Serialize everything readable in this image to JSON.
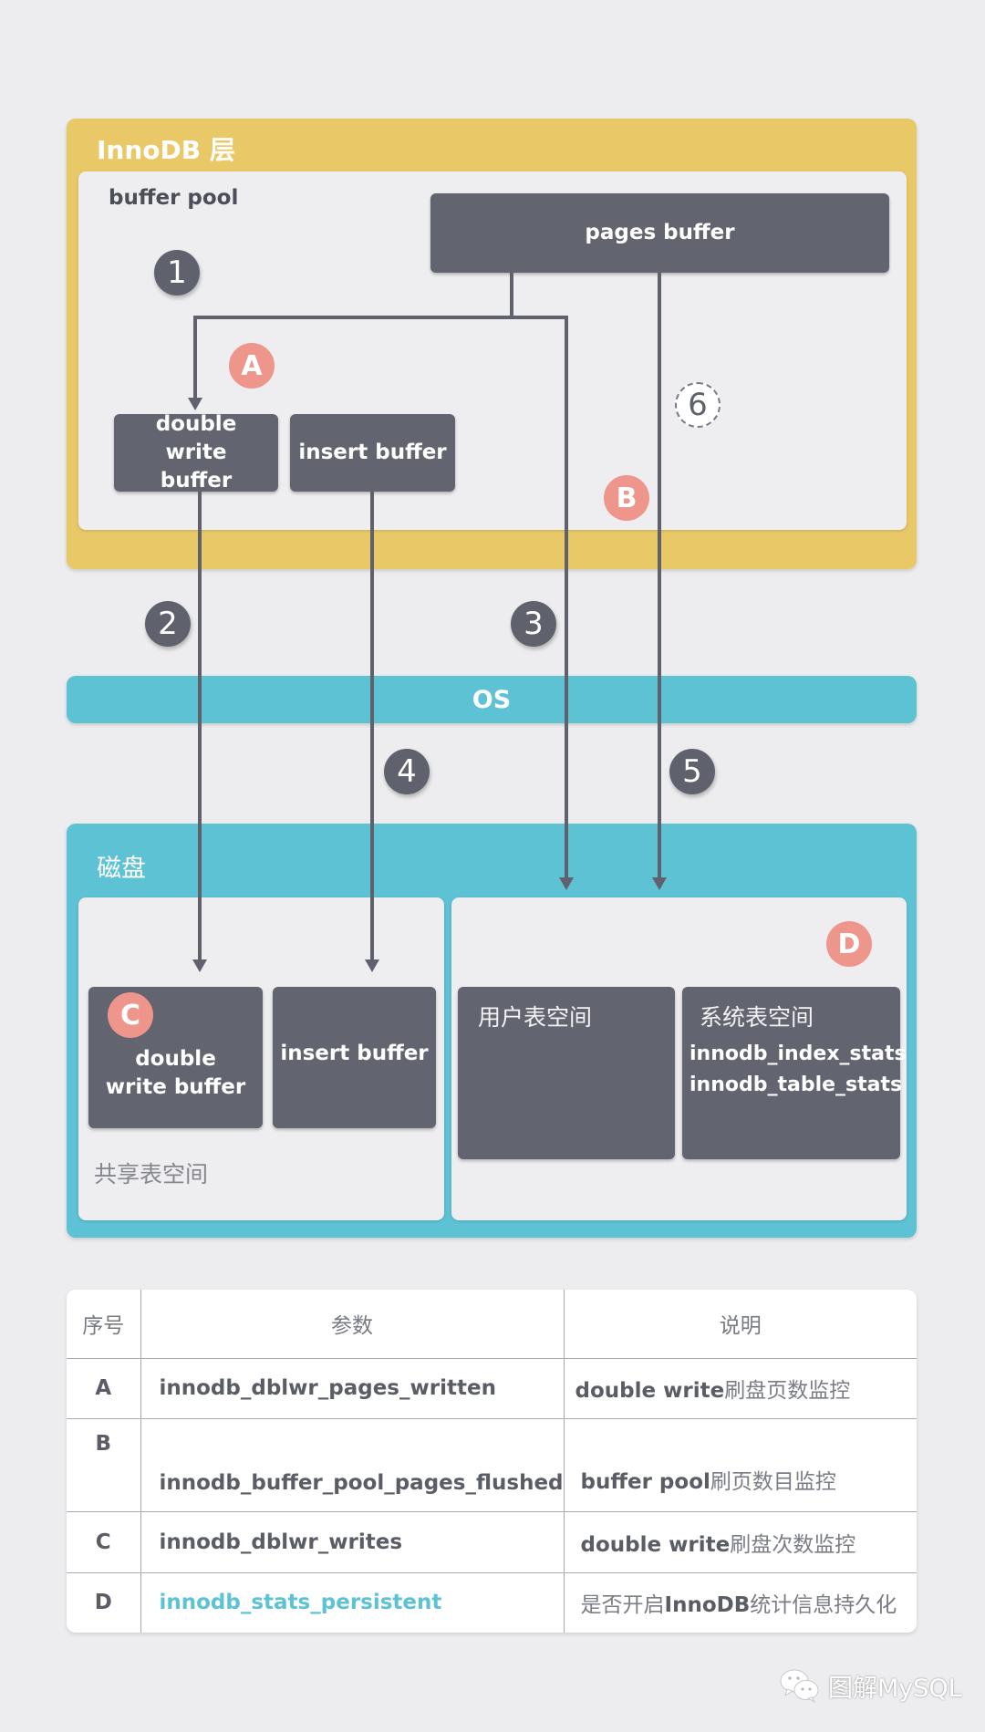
{
  "innodb_layer": {
    "title": "InnoDB 层",
    "buffer_pool": {
      "title": "buffer pool",
      "pages_buffer": "pages buffer",
      "double_write_buffer": "double write buffer",
      "insert_buffer": "insert buffer"
    }
  },
  "os_layer": {
    "title": "OS"
  },
  "disk_layer": {
    "title": "磁盘",
    "shared_tablespace": {
      "title": "共享表空间",
      "double_write_buffer": "double write buffer",
      "insert_buffer": "insert buffer"
    },
    "user_tablespace": "用户表空间",
    "system_tablespace": {
      "title": "系统表空间",
      "tables": [
        "innodb_index_stats",
        "innodb_table_stats"
      ]
    }
  },
  "steps": [
    "1",
    "2",
    "3",
    "4",
    "5",
    "6"
  ],
  "markers": [
    "A",
    "B",
    "C",
    "D"
  ],
  "table": {
    "headers": [
      "序号",
      "参数",
      "说明"
    ],
    "rows": [
      {
        "seq": "A",
        "param": "innodb_dblwr_pages_written",
        "desc_bold": "double write",
        "desc_rest": "刷盘页数监控",
        "param_color": "#5a5c66"
      },
      {
        "seq": "B",
        "param": "innodb_buffer_pool_pages_flushed",
        "desc_bold": "buffer pool",
        "desc_rest": "刷页数目监控",
        "param_color": "#5a5c66"
      },
      {
        "seq": "C",
        "param": "innodb_dblwr_writes",
        "desc_bold": "double write",
        "desc_rest": "刷盘次数监控",
        "param_color": "#5a5c66"
      },
      {
        "seq": "D",
        "param": "innodb_stats_persistent",
        "desc_pre": "是否开启",
        "desc_bold": "InnoDB",
        "desc_rest": "统计信息持久化",
        "param_color": "#5ec2d5"
      }
    ]
  },
  "watermark": {
    "icon": "wechat-icon",
    "text": "图解MySQL"
  },
  "colors": {
    "innodb_yellow": "#e8c867",
    "os_blue": "#5ec2d5",
    "box_dark": "#62646f",
    "marker_pink": "#ee958c",
    "highlight_param": "#5ec2d5"
  }
}
